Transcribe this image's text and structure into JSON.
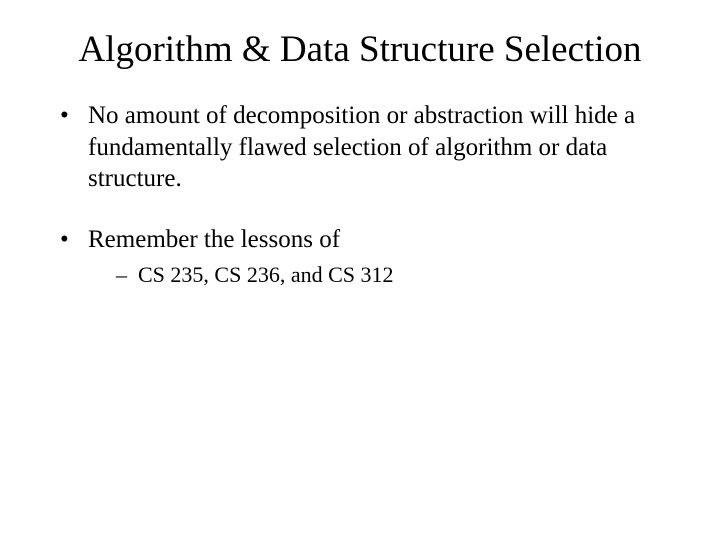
{
  "title": "Algorithm & Data Structure Selection",
  "bullets": [
    {
      "text": "No amount of decomposition or abstraction will hide a fundamentally flawed selection of algorithm or data structure."
    },
    {
      "text": "Remember the lessons of",
      "sub": [
        "CS 235, CS 236, and CS 312"
      ]
    }
  ]
}
